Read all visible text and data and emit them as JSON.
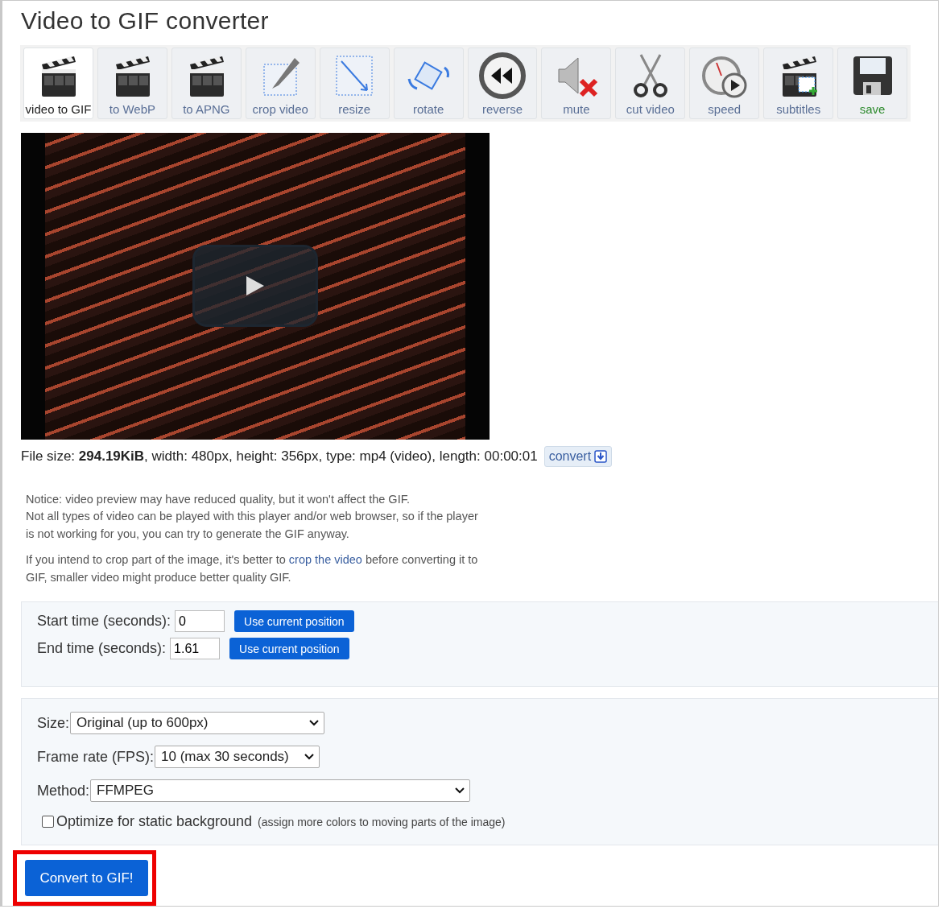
{
  "title": "Video to GIF converter",
  "tools": [
    {
      "label": "video to GIF",
      "kind": "clapper",
      "selected": true
    },
    {
      "label": "to WebP",
      "kind": "clapper",
      "selected": false
    },
    {
      "label": "to APNG",
      "kind": "clapper",
      "selected": false
    },
    {
      "label": "crop video",
      "kind": "crop",
      "selected": false
    },
    {
      "label": "resize",
      "kind": "resize",
      "selected": false
    },
    {
      "label": "rotate",
      "kind": "rotate",
      "selected": false
    },
    {
      "label": "reverse",
      "kind": "reverse",
      "selected": false
    },
    {
      "label": "mute",
      "kind": "mute",
      "selected": false
    },
    {
      "label": "cut video",
      "kind": "scissors",
      "selected": false
    },
    {
      "label": "speed",
      "kind": "speed",
      "selected": false
    },
    {
      "label": "subtitles",
      "kind": "subtitles",
      "selected": false
    },
    {
      "label": "save",
      "kind": "save",
      "selected": false
    }
  ],
  "file_info": {
    "text": "File size: **294.19KiB**, width: 480px, height: 356px, type: mp4 (video), length: 00:00:01",
    "convert_label": "convert"
  },
  "notice": {
    "lines": [
      "Notice: video preview may have reduced quality, but it won't affect the GIF.",
      "Not all types of video can be played with this player and/or web browser, so if the player",
      "is not working for you, you can try to generate the GIF anyway."
    ],
    "tip_before": "If you intend to crop part of the image, it's better to",
    "tip_link": "crop the video",
    "tip_after": "before converting it to GIF, smaller video might produce better quality GIF."
  },
  "time": [
    {
      "label": "Start time (seconds):",
      "value": "0",
      "button": "Use current position"
    },
    {
      "label": "End time (seconds):",
      "value": "1.61",
      "button": "Use current position"
    }
  ],
  "options": [
    {
      "label": "Size:",
      "value": "Original (up to 600px)",
      "kind": "wide"
    },
    {
      "label": "Frame rate (FPS):",
      "value": "10 (max 30 seconds)",
      "kind": "narrow"
    },
    {
      "label": "Method:",
      "value": "FFMPEG",
      "kind": "full"
    }
  ],
  "optimize": {
    "label": "Optimize for static background",
    "hint": "(assign more colors to moving parts of the image)",
    "checked": false
  },
  "submit": {
    "label": "Convert to GIF!",
    "highlighted": true
  }
}
